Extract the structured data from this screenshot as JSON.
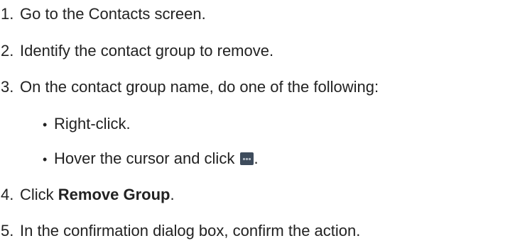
{
  "steps": [
    {
      "num": "1.",
      "text": "Go to the Contacts screen."
    },
    {
      "num": "2.",
      "text": "Identify the contact group to remove."
    },
    {
      "num": "3.",
      "text": "On the contact group name, do one of the following:"
    },
    {
      "num": "4.",
      "pre": "Click ",
      "bold": "Remove Group",
      "post": "."
    },
    {
      "num": "5.",
      "text": "In the confirmation dialog box, confirm the action."
    }
  ],
  "substeps": [
    {
      "bullet": "•",
      "text": "Right-click."
    },
    {
      "bullet": "•",
      "text": "Hover the cursor and click ",
      "icon": "more-options-icon",
      "post": "."
    }
  ],
  "colors": {
    "text": "#222222",
    "icon_bg": "#3e4c5c"
  }
}
